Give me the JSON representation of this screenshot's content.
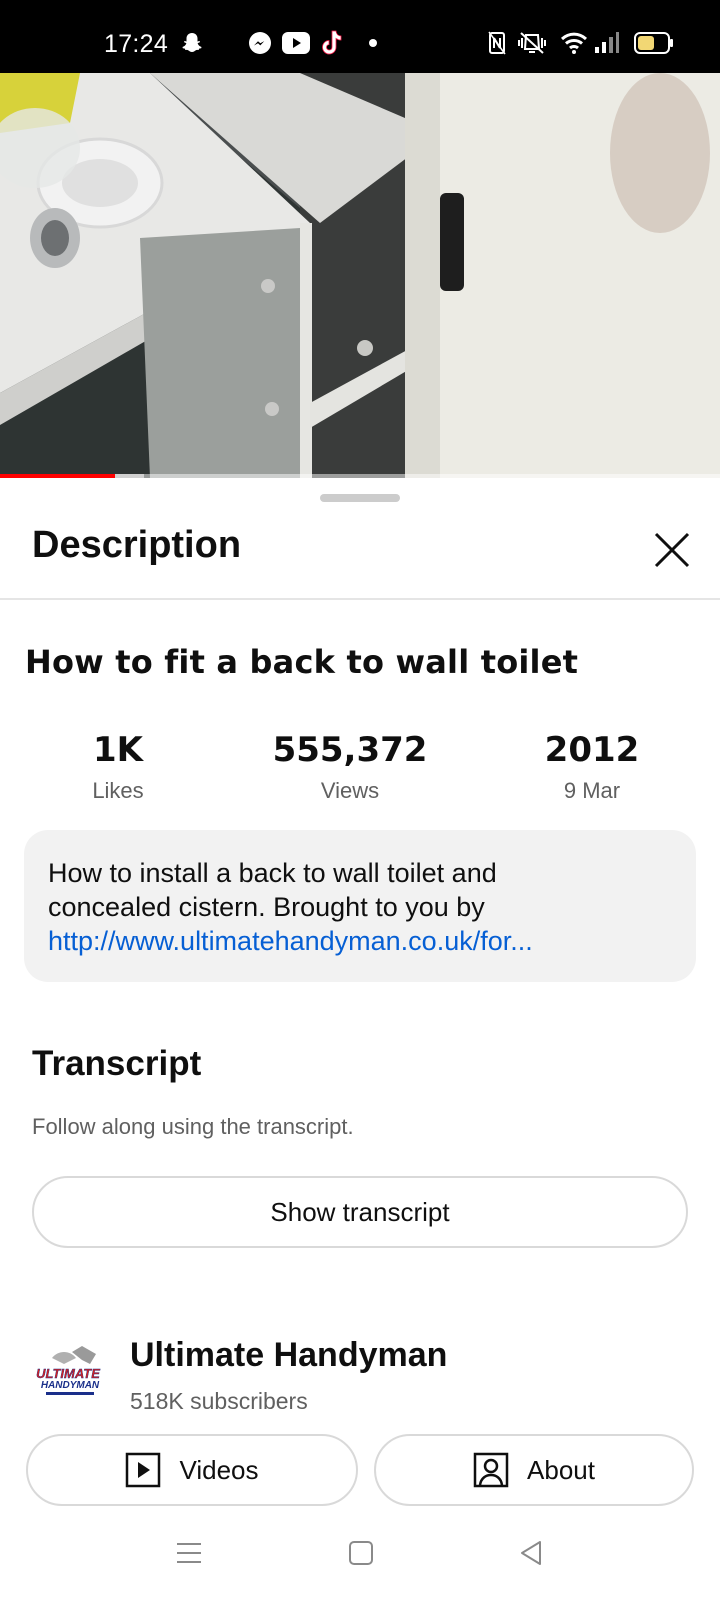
{
  "status_bar": {
    "time": "17:24",
    "icons_left": [
      "snapchat-icon",
      "messenger-icon",
      "youtube-icon",
      "tiktok-icon",
      "dot-icon"
    ],
    "icons_right": [
      "nfc-icon",
      "vibrate-icon",
      "wifi-icon",
      "signal-icon",
      "battery-icon"
    ]
  },
  "video": {
    "progress_played_fraction": 0.16,
    "progress_buffered_fraction": 0.2
  },
  "sheet": {
    "title": "Description",
    "close_icon": "close-icon"
  },
  "video_info": {
    "title": "How to fit a back to wall toilet",
    "stats": [
      {
        "value": "1K",
        "label": "Likes"
      },
      {
        "value": "555,372",
        "label": "Views"
      },
      {
        "value": "2012",
        "label": "9 Mar"
      }
    ],
    "description_line1": "How to install a back to wall toilet and",
    "description_line2": "concealed cistern. Brought to you by",
    "description_link": "http://www.ultimatehandyman.co.uk/for..."
  },
  "transcript": {
    "title": "Transcript",
    "subtitle": "Follow along using the transcript.",
    "button_label": "Show transcript"
  },
  "channel": {
    "name": "Ultimate Handyman",
    "subscribers": "518K subscribers",
    "logo_text_top": "ULTIMATE",
    "logo_text_bottom": "HANDYMAN",
    "videos_label": "Videos",
    "about_label": "About"
  },
  "nav_bar": {
    "icons": [
      "menu-icon",
      "home-icon",
      "back-icon"
    ]
  },
  "colors": {
    "progress_red": "#ff0000",
    "link_blue": "#065fd4",
    "secondary_text": "#606060"
  }
}
